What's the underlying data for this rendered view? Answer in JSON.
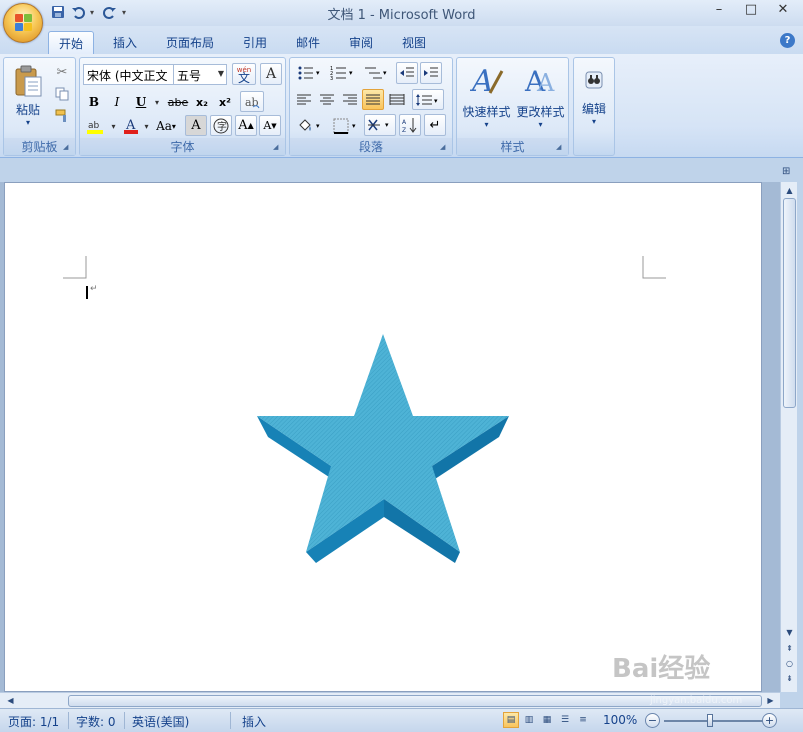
{
  "window": {
    "title": "文档 1 - Microsoft Word",
    "minimize": "–",
    "maximize": "□",
    "close": "✕"
  },
  "qat": {
    "save": "save-icon",
    "undo": "undo-icon",
    "redo": "redo-icon"
  },
  "tabs": [
    {
      "label": "开始",
      "active": true
    },
    {
      "label": "插入"
    },
    {
      "label": "页面布局"
    },
    {
      "label": "引用"
    },
    {
      "label": "邮件"
    },
    {
      "label": "审阅"
    },
    {
      "label": "视图"
    }
  ],
  "help": "?",
  "ribbon": {
    "clipboard": {
      "label": "剪贴板",
      "paste": "粘贴"
    },
    "font": {
      "label": "字体",
      "font_name": "宋体 (中文正文",
      "font_size": "五号",
      "bold": "B",
      "italic": "I",
      "underline": "U",
      "strike": "abe",
      "subscript": "x₂",
      "superscript": "x²",
      "change_case": "Aa",
      "char_border": "A",
      "grow": "A",
      "shrink": "A",
      "phonetic": "wén",
      "phonetic_char": "文"
    },
    "paragraph": {
      "label": "段落"
    },
    "styles": {
      "label": "样式",
      "quick_styles": "快速样式",
      "change_styles": "更改样式"
    },
    "editing": {
      "label": "编辑"
    }
  },
  "document": {
    "shape": "star",
    "fill_color": "#4aaed1",
    "side_color": "#1a86b8"
  },
  "status": {
    "page": "页面: 1/1",
    "words": "字数: 0",
    "language": "英语(美国)",
    "mode": "插入",
    "zoom": "100%",
    "zoom_percent": 100
  },
  "watermark": {
    "brand": "Bai经验",
    "url": "jingyan.baidu.com"
  }
}
